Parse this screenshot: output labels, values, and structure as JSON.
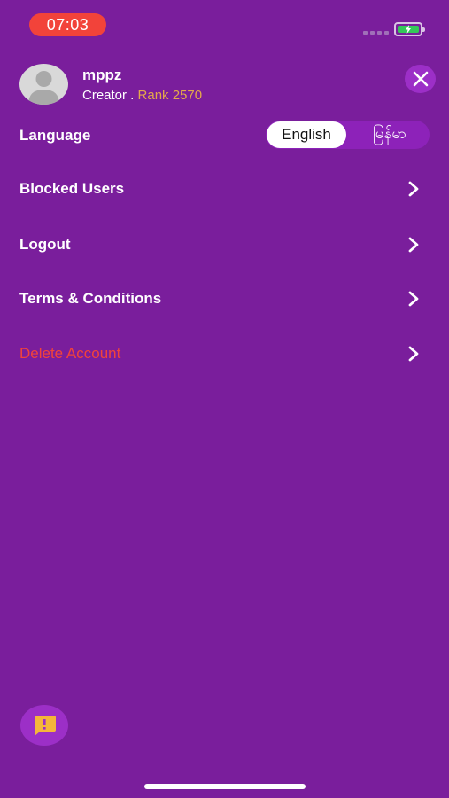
{
  "status_bar": {
    "time": "07:03"
  },
  "profile": {
    "username": "mppz",
    "role": "Creator .",
    "rank": "Rank 2570"
  },
  "language": {
    "label": "Language",
    "options": [
      "English",
      "မြန်မာ"
    ],
    "selected": "English"
  },
  "menu": [
    {
      "label": "Blocked Users"
    },
    {
      "label": "Logout"
    },
    {
      "label": "Terms & Conditions"
    },
    {
      "label": "Delete Account",
      "style": "danger"
    }
  ],
  "colors": {
    "background": "#7a1e9c",
    "accent_circle": "#9c2fc7",
    "rank_text": "#e4a94a",
    "danger_text": "#f2433a",
    "time_pill": "#f2433a",
    "battery": "#34c759"
  },
  "icons": {
    "close": "close-icon",
    "chevron": "chevron-right-icon",
    "feedback": "feedback-icon",
    "avatar": "avatar-placeholder-icon",
    "battery": "battery-charging-icon"
  }
}
